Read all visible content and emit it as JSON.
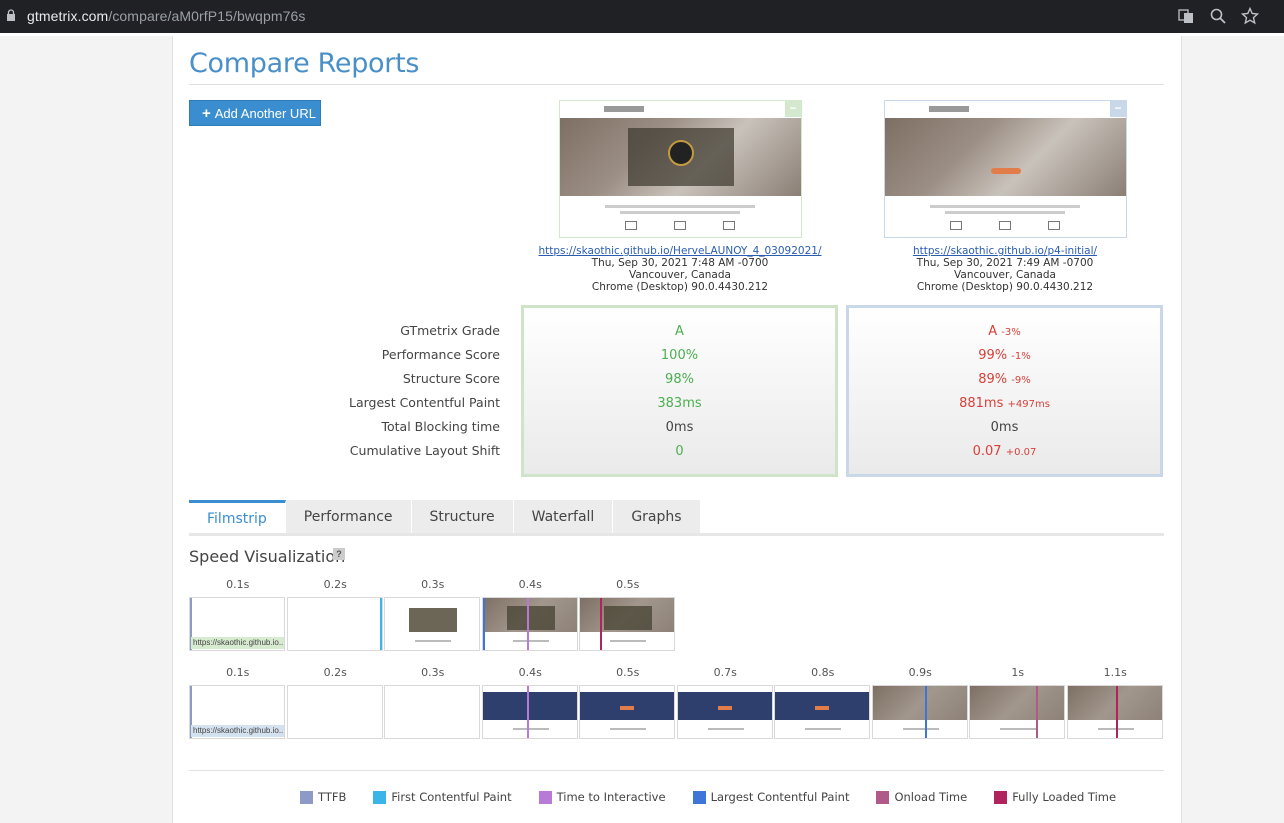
{
  "browser": {
    "url_host": "gtmetrix.com",
    "url_path": "/compare/aM0rfP15/bwqpm76s"
  },
  "page": {
    "title": "Compare Reports",
    "add_url_label": "Add Another URL"
  },
  "reports": [
    {
      "url": "https://skaothic.github.io/HerveLAUNOY_4_03092021/",
      "date": "Thu, Sep 30, 2021 7:48 AM -0700",
      "location": "Vancouver, Canada",
      "browser": "Chrome (Desktop) 90.0.4430.212",
      "accent": "#d3e8cc",
      "grade": "A",
      "performance": "100%",
      "structure": "98%",
      "lcp": "383ms",
      "tbt": "0ms",
      "cls": "0"
    },
    {
      "url": "https://skaothic.github.io/p4-initial/",
      "date": "Thu, Sep 30, 2021 7:49 AM -0700",
      "location": "Vancouver, Canada",
      "browser": "Chrome (Desktop) 90.0.4430.212",
      "accent": "#c9d8e8",
      "grade": "A",
      "grade_diff": "-3%",
      "performance": "99%",
      "performance_diff": "-1%",
      "structure": "89%",
      "structure_diff": "-9%",
      "lcp": "881ms",
      "lcp_diff": "+497ms",
      "tbt": "0ms",
      "cls": "0.07",
      "cls_diff": "+0.07"
    }
  ],
  "metric_labels": {
    "grade": "GTmetrix Grade",
    "performance": "Performance Score",
    "structure": "Structure Score",
    "lcp": "Largest Contentful Paint",
    "tbt": "Total Blocking time",
    "cls": "Cumulative Layout Shift"
  },
  "tabs": [
    "Filmstrip",
    "Performance",
    "Structure",
    "Waterfall",
    "Graphs"
  ],
  "speed": {
    "title": "Speed Visualization",
    "help": "?",
    "row1_times": [
      "0.1s",
      "0.2s",
      "0.3s",
      "0.4s",
      "0.5s"
    ],
    "row2_times": [
      "0.1s",
      "0.2s",
      "0.3s",
      "0.4s",
      "0.5s",
      "0.7s",
      "0.8s",
      "0.9s",
      "1s",
      "1.1s"
    ],
    "caption": "https://skaothic.github.io..."
  },
  "legend": [
    {
      "label": "TTFB",
      "color": "#8e9ac6"
    },
    {
      "label": "First Contentful Paint",
      "color": "#3bb5e8"
    },
    {
      "label": "Time to Interactive",
      "color": "#b77ad6"
    },
    {
      "label": "Largest Contentful Paint",
      "color": "#3f74d8"
    },
    {
      "label": "Onload Time",
      "color": "#b05a8a"
    },
    {
      "label": "Fully Loaded Time",
      "color": "#b0245e"
    }
  ]
}
